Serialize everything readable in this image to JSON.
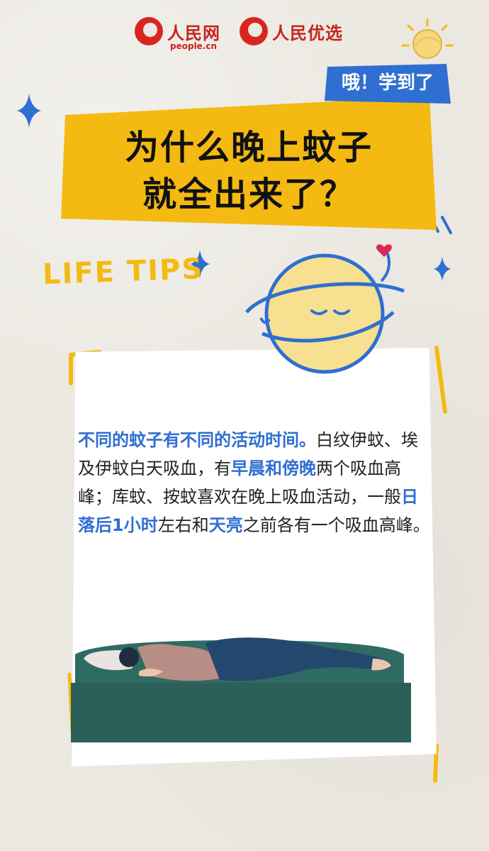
{
  "header": {
    "logo1_text": "人民网",
    "logo1_sub": "people.cn",
    "logo2_text": "人民优选"
  },
  "tag": "哦！学到了",
  "title": {
    "line1": "为什么晚上蚊子",
    "line2": "就全出来了？"
  },
  "section_label": "LIFE TIPS",
  "body": {
    "p1": "不同的蚊子有不同的活动时间。",
    "p2": "白纹伊蚊、埃及伊蚊白天吸血，有",
    "p3": "早晨和傍晚",
    "p4": "两个吸血高峰；库蚊、按蚊喜欢在晚上吸血活动，一般",
    "p5": "日落后1小时",
    "p6": "左右和",
    "p7": "天亮",
    "p8": "之前各有一个吸血高峰。"
  },
  "colors": {
    "yellow": "#f4ba12",
    "blue": "#2f6fd1",
    "card": "#ffffff",
    "sofa": "#2f6b63"
  },
  "icons": [
    "sun-icon",
    "sparkle-icon",
    "planet-character-icon",
    "sleeping-person-illustration"
  ]
}
